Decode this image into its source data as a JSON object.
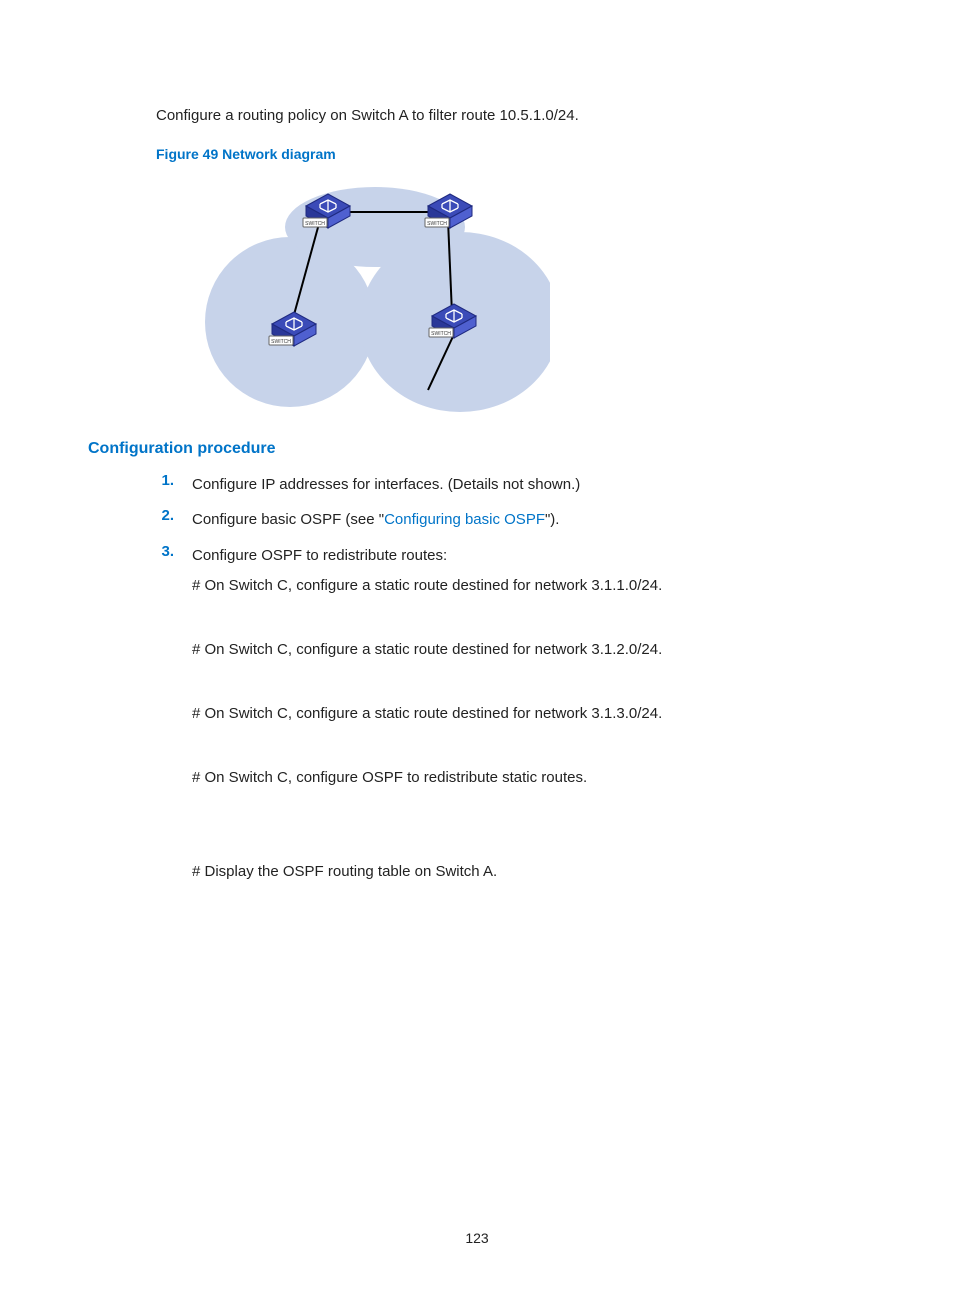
{
  "intro": "Configure a routing policy on Switch A to filter route 10.5.1.0/24.",
  "figure_caption": "Figure 49 Network diagram",
  "section_heading": "Configuration procedure",
  "steps": [
    {
      "num": "1.",
      "text": "Configure IP addresses for interfaces. (Details not shown.)"
    },
    {
      "num": "2.",
      "prefix": "Configure basic OSPF (see \"",
      "link": "Configuring basic OSPF",
      "suffix": "\")."
    },
    {
      "num": "3.",
      "text": "Configure OSPF to redistribute routes:"
    }
  ],
  "substeps": [
    "# On Switch C, configure a static route destined for network 3.1.1.0/24.",
    "# On Switch C, configure a static route destined for network 3.1.2.0/24.",
    "# On Switch C, configure a static route destined for network 3.1.3.0/24.",
    "# On Switch C, configure OSPF to redistribute static routes.",
    "# Display the OSPF routing table on Switch A."
  ],
  "page_number": "123"
}
